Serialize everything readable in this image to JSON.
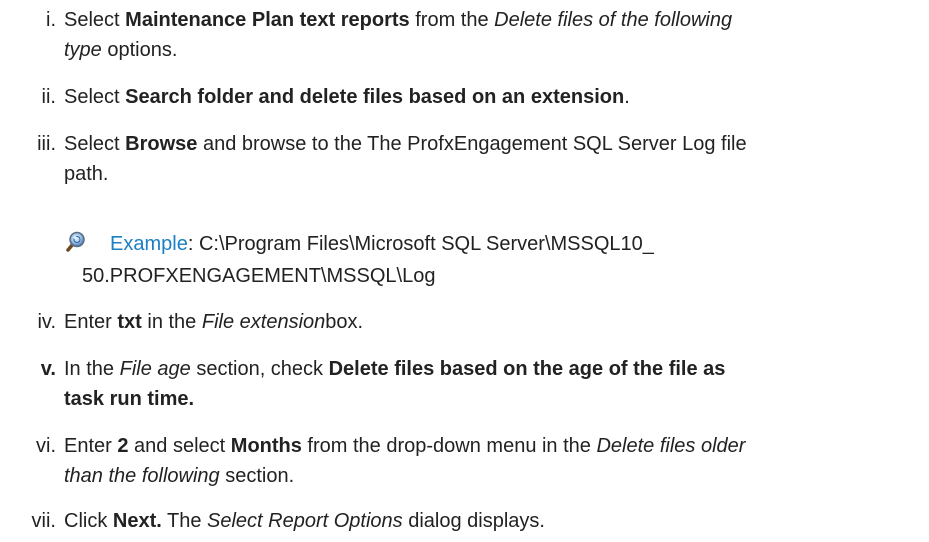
{
  "steps": [
    {
      "num": "i.",
      "parts": {
        "a": "Select ",
        "b": "Maintenance Plan text reports",
        "c": " from the ",
        "d": "Delete files of the following",
        "e": "type",
        "f": " options."
      }
    },
    {
      "num": "ii.",
      "parts": {
        "a": "Select ",
        "b": "Search folder and delete files based on an extension",
        "c": "."
      }
    },
    {
      "num": "iii.",
      "parts": {
        "a": "Select ",
        "b": "Browse",
        "c": " and browse to the The ProfxEngagement SQL Server Log file",
        "d": "path."
      }
    },
    {
      "num": "iv.",
      "parts": {
        "a": "Enter ",
        "b": "txt",
        "c": " in the ",
        "d": "File extension",
        "e": "box."
      }
    },
    {
      "num": "v.",
      "parts": {
        "a": "In the ",
        "b": "File age",
        "c": " section, check ",
        "d": "Delete files based on the age of the file as",
        "e": "task run time."
      }
    },
    {
      "num": "vi.",
      "parts": {
        "a": "Enter ",
        "b": "2",
        "c": " and select ",
        "d": "Months",
        "e": " from the drop-down menu in the ",
        "f": "Delete files older",
        "g": "than the following",
        "h": " section."
      }
    },
    {
      "num": "vii.",
      "parts": {
        "a": "Click ",
        "b": "Next.",
        "c": " The ",
        "d": "Select Report Options",
        "e": " dialog displays."
      }
    }
  ],
  "example": {
    "icon": "magnifier-example-icon",
    "label": "Example",
    "colon": ": ",
    "line1": "C:\\Program Files\\Microsoft SQL Server\\MSSQL10_",
    "line2": "50.PROFXENGAGEMENT\\MSSQL\\Log",
    "label_color": "#1a7fc4"
  }
}
